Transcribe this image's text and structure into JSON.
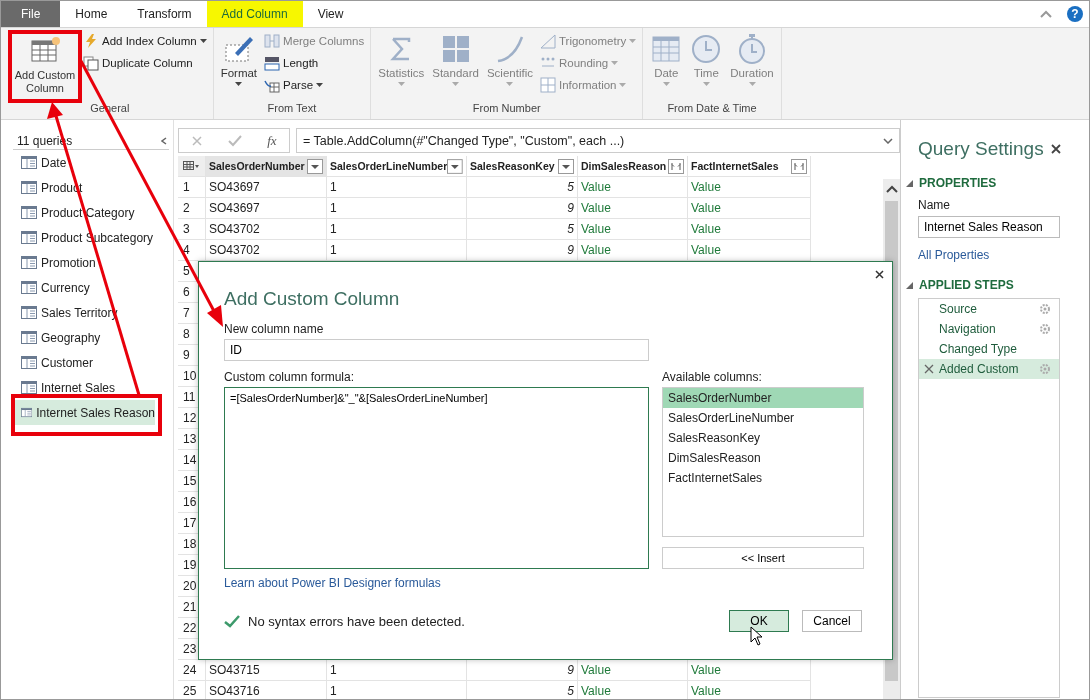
{
  "ribbon": {
    "tabs": [
      {
        "label": "File",
        "kind": "file",
        "selected": false
      },
      {
        "label": "Home",
        "kind": "tab",
        "selected": false
      },
      {
        "label": "Transform",
        "kind": "tab",
        "selected": false
      },
      {
        "label": "Add Column",
        "kind": "tab",
        "selected": true
      },
      {
        "label": "View",
        "kind": "tab",
        "selected": false
      }
    ],
    "help": "?",
    "groups": [
      {
        "label": "General",
        "items": [
          {
            "label": "Add Custom Column",
            "kind": "large",
            "dropdown": false,
            "disabled": false
          },
          {
            "label": "Add Index Column",
            "kind": "small",
            "dropdown": true,
            "disabled": false
          },
          {
            "label": "Duplicate Column",
            "kind": "small",
            "dropdown": false,
            "disabled": false
          }
        ]
      },
      {
        "label": "From Text",
        "items": [
          {
            "label": "Format",
            "kind": "large",
            "dropdown": true,
            "disabled": false
          },
          {
            "label": "Merge Columns",
            "kind": "small",
            "dropdown": false,
            "disabled": true
          },
          {
            "label": "Length",
            "kind": "small",
            "dropdown": false,
            "disabled": false
          },
          {
            "label": "Parse",
            "kind": "small",
            "dropdown": true,
            "disabled": false
          }
        ]
      },
      {
        "label": "From Number",
        "items": [
          {
            "label": "Statistics",
            "kind": "large",
            "dropdown": true,
            "disabled": true
          },
          {
            "label": "Standard",
            "kind": "large",
            "dropdown": true,
            "disabled": true
          },
          {
            "label": "Scientific",
            "kind": "large",
            "dropdown": true,
            "disabled": true
          },
          {
            "label": "Trigonometry",
            "kind": "small",
            "dropdown": true,
            "disabled": true
          },
          {
            "label": "Rounding",
            "kind": "small",
            "dropdown": true,
            "disabled": true
          },
          {
            "label": "Information",
            "kind": "small",
            "dropdown": true,
            "disabled": true
          }
        ]
      },
      {
        "label": "From Date & Time",
        "items": [
          {
            "label": "Date",
            "kind": "large",
            "dropdown": true,
            "disabled": true
          },
          {
            "label": "Time",
            "kind": "large",
            "dropdown": true,
            "disabled": true
          },
          {
            "label": "Duration",
            "kind": "large",
            "dropdown": true,
            "disabled": true
          }
        ]
      }
    ]
  },
  "queries": {
    "count_label": "11 queries",
    "items": [
      {
        "label": "Date",
        "selected": false
      },
      {
        "label": "Product",
        "selected": false
      },
      {
        "label": "Product Category",
        "selected": false
      },
      {
        "label": "Product Subcategory",
        "selected": false
      },
      {
        "label": "Promotion",
        "selected": false
      },
      {
        "label": "Currency",
        "selected": false
      },
      {
        "label": "Sales Territory",
        "selected": false
      },
      {
        "label": "Geography",
        "selected": false
      },
      {
        "label": "Customer",
        "selected": false
      },
      {
        "label": "Internet Sales",
        "selected": false
      },
      {
        "label": "Internet Sales Reason",
        "selected": true
      }
    ]
  },
  "formula_bar": {
    "function_label": "fx",
    "formula": "= Table.AddColumn(#\"Changed Type\", \"Custom\", each ...)"
  },
  "grid": {
    "columns": [
      {
        "name": "SalesOrderNumber",
        "kind": "text",
        "selected": true
      },
      {
        "name": "SalesOrderLineNumber",
        "kind": "text",
        "selected": false
      },
      {
        "name": "SalesReasonKey",
        "kind": "number",
        "selected": false
      },
      {
        "name": "DimSalesReason",
        "kind": "record",
        "selected": false
      },
      {
        "name": "FactInternetSales",
        "kind": "record",
        "selected": false
      }
    ],
    "rows": [
      {
        "number": "1",
        "cells": [
          "SO43697",
          "1",
          "5",
          "Value",
          "Value"
        ]
      },
      {
        "number": "2",
        "cells": [
          "SO43697",
          "1",
          "9",
          "Value",
          "Value"
        ]
      },
      {
        "number": "3",
        "cells": [
          "SO43702",
          "1",
          "5",
          "Value",
          "Value"
        ]
      },
      {
        "number": "4",
        "cells": [
          "SO43702",
          "1",
          "9",
          "Value",
          "Value"
        ]
      },
      {
        "number": "5"
      },
      {
        "number": "6"
      },
      {
        "number": "7"
      },
      {
        "number": "8"
      },
      {
        "number": "9"
      },
      {
        "number": "10"
      },
      {
        "number": "11"
      },
      {
        "number": "12"
      },
      {
        "number": "13"
      },
      {
        "number": "14"
      },
      {
        "number": "15"
      },
      {
        "number": "16"
      },
      {
        "number": "17"
      },
      {
        "number": "18"
      },
      {
        "number": "19"
      },
      {
        "number": "20"
      },
      {
        "number": "21"
      },
      {
        "number": "22"
      },
      {
        "number": "23"
      },
      {
        "number": "24",
        "cells": [
          "SO43715",
          "1",
          "9",
          "Value",
          "Value"
        ]
      },
      {
        "number": "25",
        "cells": [
          "SO43716",
          "1",
          "5",
          "Value",
          "Value"
        ]
      }
    ]
  },
  "settings": {
    "title": "Query Settings",
    "properties_heading": "PROPERTIES",
    "name_label": "Name",
    "name_value": "Internet Sales Reason",
    "properties_link": "All Properties",
    "steps_heading": "APPLIED STEPS",
    "steps": [
      {
        "label": "Source",
        "has_settings": true,
        "selected": false
      },
      {
        "label": "Navigation",
        "has_settings": true,
        "selected": false
      },
      {
        "label": "Changed Type",
        "has_settings": false,
        "selected": false
      },
      {
        "label": "Added Custom",
        "has_settings": true,
        "selected": true
      }
    ]
  },
  "dialog": {
    "title": "Add Custom Column",
    "name_label": "New column name",
    "name_value": "ID",
    "formula_label": "Custom column formula:",
    "formula": "=[SalesOrderNumber]&\"_\"&[SalesOrderLineNumber]",
    "columns_label": "Available columns:",
    "columns": [
      {
        "label": "SalesOrderNumber",
        "selected": true
      },
      {
        "label": "SalesOrderLineNumber",
        "selected": false
      },
      {
        "label": "SalesReasonKey",
        "selected": false
      },
      {
        "label": "DimSalesReason",
        "selected": false
      },
      {
        "label": "FactInternetSales",
        "selected": false
      }
    ],
    "insert_button": "<< Insert",
    "help_link": "Learn about Power BI Designer formulas",
    "status": {
      "ok": true,
      "message": "No syntax errors have been detected."
    },
    "buttons": [
      {
        "label": "OK",
        "kind": "primary"
      },
      {
        "label": "Cancel",
        "kind": "secondary"
      }
    ]
  }
}
